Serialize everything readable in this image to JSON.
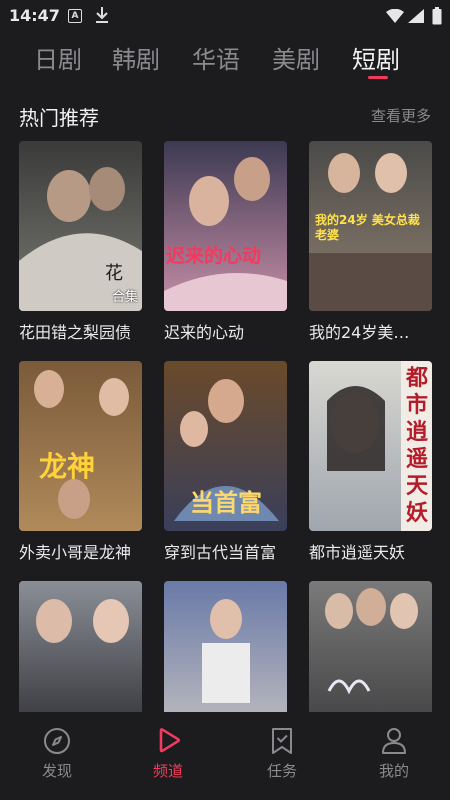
{
  "status_bar": {
    "time": "14:47",
    "a_icon_letter": "A"
  },
  "tabs": [
    {
      "label": "日剧",
      "active": false
    },
    {
      "label": "韩剧",
      "active": false
    },
    {
      "label": "华语",
      "active": false
    },
    {
      "label": "美剧",
      "active": false
    },
    {
      "label": "短剧",
      "active": true
    }
  ],
  "section": {
    "title": "热门推荐",
    "more": "查看更多"
  },
  "cards": [
    {
      "title": "花田错之梨园债",
      "badge": "合集",
      "poster_text": "花",
      "colors": [
        "#3a3a3a",
        "#7a7a72"
      ]
    },
    {
      "title": "迟来的心动",
      "poster_text": "迟来的心动",
      "colors": [
        "#3c3a52",
        "#c98fa8"
      ]
    },
    {
      "title": "我的24岁美…",
      "poster_text": "我的24岁 美女总裁老婆",
      "colors": [
        "#4a4a48",
        "#8f7f70"
      ]
    },
    {
      "title": "外卖小哥是龙神",
      "poster_text": "龙神",
      "colors": [
        "#7a5a3a",
        "#b08a5a"
      ]
    },
    {
      "title": "穿到古代当首富",
      "poster_text": "当首富",
      "colors": [
        "#6a4a2a",
        "#3a3f5a"
      ]
    },
    {
      "title": "都市逍遥天妖",
      "poster_text": "都市逍遥天妖",
      "colors": [
        "#d8d8d2",
        "#a0a6ae"
      ]
    },
    {
      "title": "",
      "poster_text": "",
      "colors": [
        "#2a2a2e",
        "#8a8e96"
      ]
    },
    {
      "title": "",
      "poster_text": "",
      "colors": [
        "#6a7aa8",
        "#c8c4c0"
      ]
    },
    {
      "title": "",
      "poster_text": "",
      "colors": [
        "#3a3a3c",
        "#7a7a7a"
      ]
    }
  ],
  "bottom_nav": [
    {
      "label": "发现",
      "icon": "compass-icon",
      "active": false
    },
    {
      "label": "频道",
      "icon": "play-icon",
      "active": true
    },
    {
      "label": "任务",
      "icon": "bookmark-check-icon",
      "active": false
    },
    {
      "label": "我的",
      "icon": "user-icon",
      "active": false
    }
  ],
  "colors": {
    "accent": "#f23a5f",
    "background": "#1c1c1e"
  }
}
